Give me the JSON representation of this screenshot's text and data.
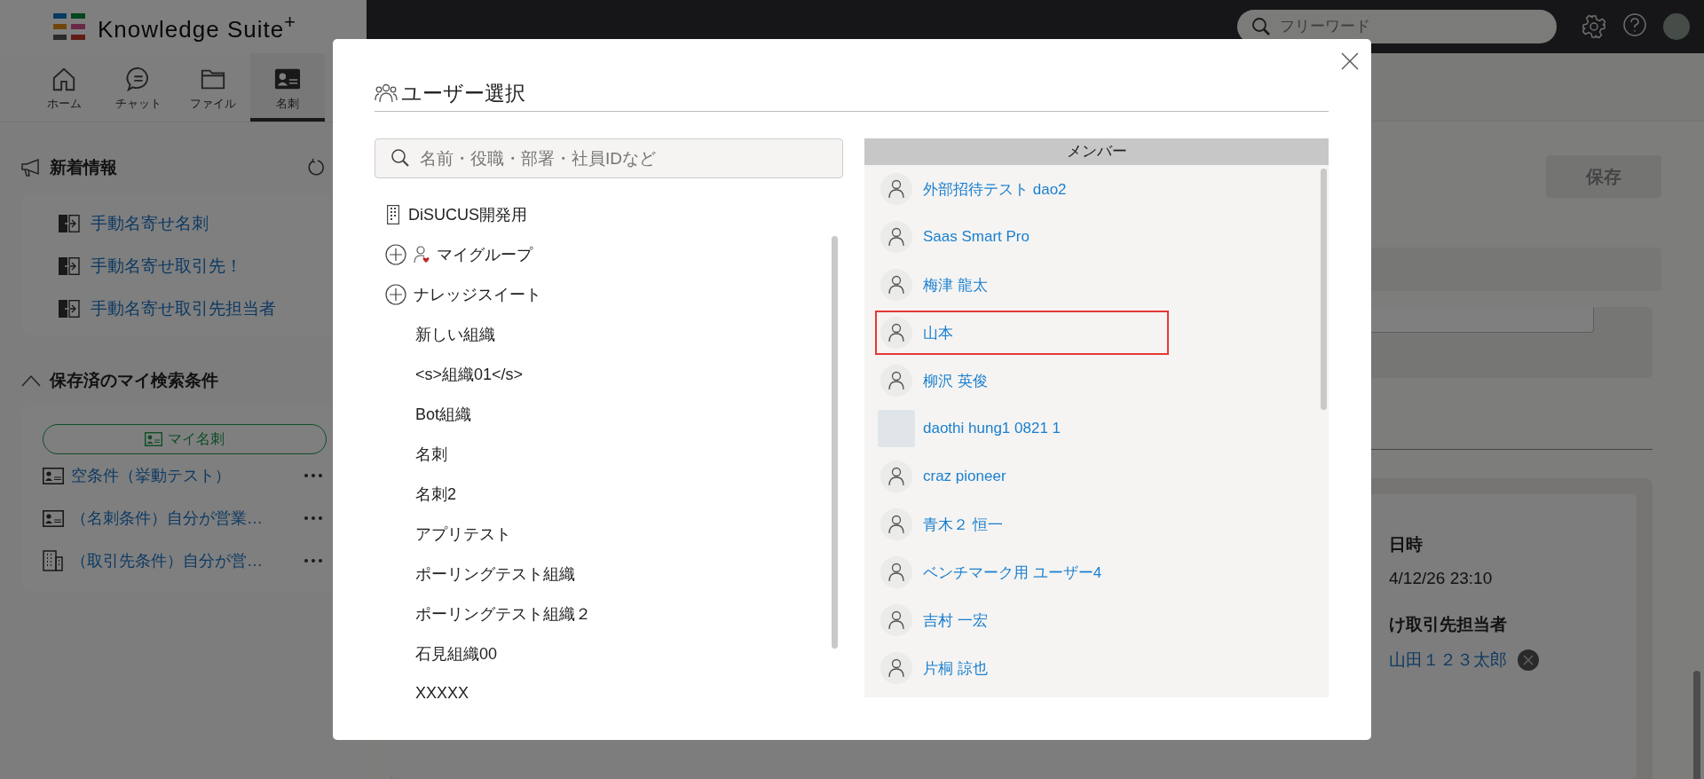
{
  "app": {
    "title": "Knowledge Suite$^{+}$"
  },
  "nav": [
    {
      "kind": "home",
      "label": "ホーム",
      "selected": false
    },
    {
      "kind": "chat",
      "label": "チャット",
      "selected": false
    },
    {
      "kind": "file",
      "label": "ファイル",
      "selected": false
    },
    {
      "kind": "card",
      "label": "名刺",
      "selected": true
    }
  ],
  "header": {
    "search_placeholder": "フリーワード"
  },
  "sidebar": {
    "news": {
      "title": "新着情報",
      "items": [
        "手動名寄せ名刺",
        "手動名寄せ取引先！",
        "手動名寄せ取引先担当者"
      ]
    },
    "saved": {
      "title": "保存済のマイ検索条件",
      "expanded": true,
      "my_card_button": "マイ名刺",
      "items": [
        {
          "kind": "card",
          "label": "空条件（挙動テスト）"
        },
        {
          "kind": "card",
          "label": "（名刺条件）自分が営業…"
        },
        {
          "kind": "company",
          "label": "（取引先条件）自分が営…"
        }
      ]
    }
  },
  "main": {
    "save_button": "保存",
    "fields": [
      {
        "kind": "text",
        "label": "日時",
        "value": "4/12/26 23:10"
      },
      {
        "kind": "person",
        "label": "け取引先担当者",
        "value": "山田１２３太郎"
      }
    ]
  },
  "dialog": {
    "title": "ユーザー選択",
    "search_placeholder": "名前・役職・部署・社員IDなど",
    "tree": [
      {
        "kind": "company",
        "label": "DiSUCUS開発用"
      },
      {
        "kind": "my-group",
        "label": "マイグループ"
      },
      {
        "kind": "group",
        "label": "ナレッジスイート"
      },
      {
        "kind": "org",
        "label": "新しい組織"
      },
      {
        "kind": "org",
        "label": "<s>組織01</s>"
      },
      {
        "kind": "org",
        "label": "Bot組織"
      },
      {
        "kind": "org",
        "label": "名刺"
      },
      {
        "kind": "org",
        "label": "名刺2"
      },
      {
        "kind": "org",
        "label": "アプリテスト"
      },
      {
        "kind": "org",
        "label": "ポーリングテスト組織"
      },
      {
        "kind": "org",
        "label": "ポーリングテスト組織２"
      },
      {
        "kind": "org",
        "label": "石見組織00"
      },
      {
        "kind": "org",
        "label": "XXXXX"
      }
    ],
    "members_header": "メンバー",
    "members": [
      {
        "kind": "default",
        "name": "外部招待テスト dao2",
        "selected": false
      },
      {
        "kind": "default",
        "name": "Saas Smart Pro",
        "selected": false
      },
      {
        "kind": "default",
        "name": "梅津 龍太",
        "selected": false
      },
      {
        "kind": "default",
        "name": "山本",
        "selected": true
      },
      {
        "kind": "default",
        "name": "柳沢 英俊",
        "selected": false
      },
      {
        "kind": "photo",
        "name": "daothi hung1 0821 1",
        "selected": false
      },
      {
        "kind": "default",
        "name": "craz pioneer",
        "selected": false
      },
      {
        "kind": "default",
        "name": "青木２ 恒一",
        "selected": false
      },
      {
        "kind": "default",
        "name": "ベンチマーク用 ユーザー4",
        "selected": false
      },
      {
        "kind": "default",
        "name": "吉村 一宏",
        "selected": false
      },
      {
        "kind": "default",
        "name": "片桐 諒也",
        "selected": false
      }
    ]
  }
}
